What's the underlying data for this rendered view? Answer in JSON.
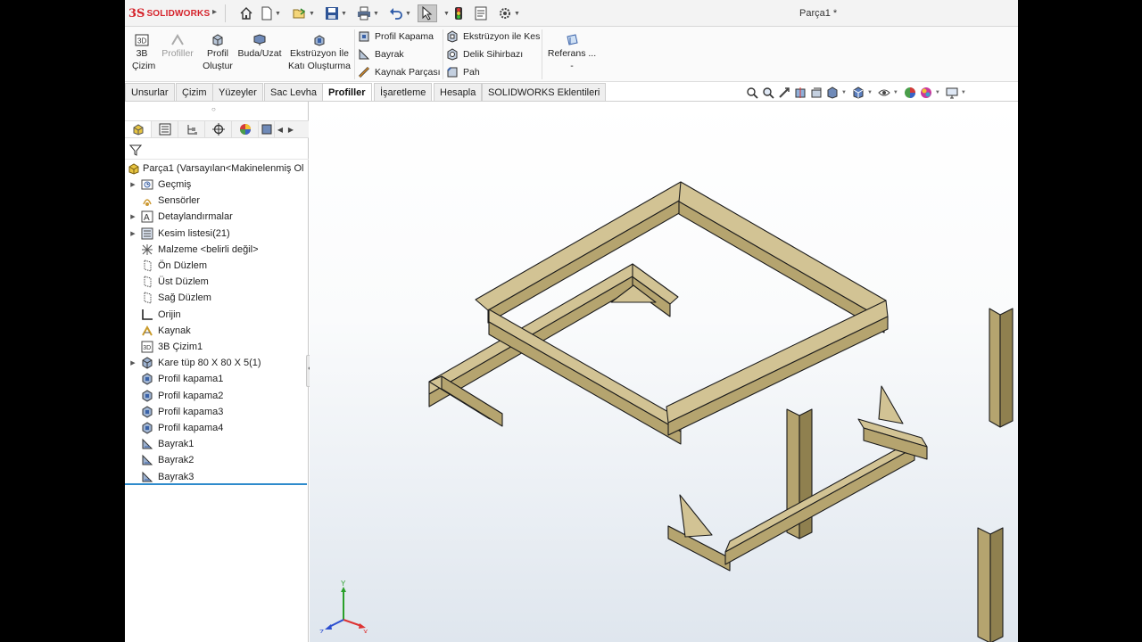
{
  "app": {
    "brand_ds": "3S",
    "brand": "SOLIDWORKS",
    "doc_title": "Parça1 *"
  },
  "ribbon": {
    "big": [
      {
        "line1": "3B",
        "line2": "Çizim",
        "icon": "3d-sketch-icon"
      },
      {
        "line1": "Profiller",
        "line2": "",
        "icon": "weldments-icon",
        "disabled": true
      },
      {
        "line1": "Profil",
        "line2": "Oluştur",
        "icon": "structural-member-icon"
      },
      {
        "line1": "Buda/Uzat",
        "line2": "",
        "icon": "trim-extend-icon"
      },
      {
        "line1": "Ekstrüzyon İle",
        "line2": "Katı Oluşturma",
        "icon": "extruded-boss-icon"
      }
    ],
    "col1": [
      "Profil Kapama",
      "Bayrak",
      "Kaynak Parçası"
    ],
    "col2": [
      "Ekstrüzyon ile Kes",
      "Delik Sihirbazı",
      "Pah"
    ],
    "ref": {
      "label": "Referans ...",
      "more": "-"
    }
  },
  "tabs": [
    "Unsurlar",
    "Çizim",
    "Yüzeyler",
    "Sac Levha",
    "Profiller",
    "İşaretleme",
    "Hesapla",
    "SOLIDWORKS Eklentileri"
  ],
  "active_tab": "Profiller",
  "tree": {
    "root": "Parça1  (Varsayılan<Makinelenmiş Ol",
    "items": [
      {
        "label": "Geçmiş",
        "expand": true,
        "icon": "history-icon"
      },
      {
        "label": "Sensörler",
        "expand": false,
        "icon": "sensor-icon"
      },
      {
        "label": "Detaylandırmalar",
        "expand": true,
        "icon": "annotations-icon"
      },
      {
        "label": "Kesim listesi(21)",
        "expand": true,
        "icon": "cut-list-icon"
      },
      {
        "label": "Malzeme <belirli değil>",
        "expand": false,
        "icon": "material-icon"
      },
      {
        "label": "Ön Düzlem",
        "expand": false,
        "icon": "plane-icon"
      },
      {
        "label": "Üst Düzlem",
        "expand": false,
        "icon": "plane-icon"
      },
      {
        "label": "Sağ Düzlem",
        "expand": false,
        "icon": "plane-icon"
      },
      {
        "label": "Orijin",
        "expand": false,
        "icon": "origin-icon"
      },
      {
        "label": "Kaynak",
        "expand": false,
        "icon": "weldment-icon"
      },
      {
        "label": "3B Çizim1",
        "expand": false,
        "icon": "3d-sketch-icon"
      },
      {
        "label": "Kare tüp 80 X 80 X 5(1)",
        "expand": true,
        "icon": "structural-member-icon"
      },
      {
        "label": "Profil kapama1",
        "expand": false,
        "icon": "end-cap-icon"
      },
      {
        "label": "Profil kapama2",
        "expand": false,
        "icon": "end-cap-icon"
      },
      {
        "label": "Profil kapama3",
        "expand": false,
        "icon": "end-cap-icon"
      },
      {
        "label": "Profil kapama4",
        "expand": false,
        "icon": "end-cap-icon"
      },
      {
        "label": "Bayrak1",
        "expand": false,
        "icon": "gusset-icon"
      },
      {
        "label": "Bayrak2",
        "expand": false,
        "icon": "gusset-icon"
      },
      {
        "label": "Bayrak3",
        "expand": false,
        "icon": "gusset-icon"
      }
    ]
  },
  "triad": {
    "y": "Y",
    "x": "X",
    "z": "Z"
  },
  "colors": {
    "accent": "#2e8bcc",
    "brand": "#d5222a",
    "frame_top": "#d2c394",
    "frame_side": "#b5a46f",
    "frame_dark": "#8f804f",
    "frame_edge": "#1c1c1c"
  }
}
